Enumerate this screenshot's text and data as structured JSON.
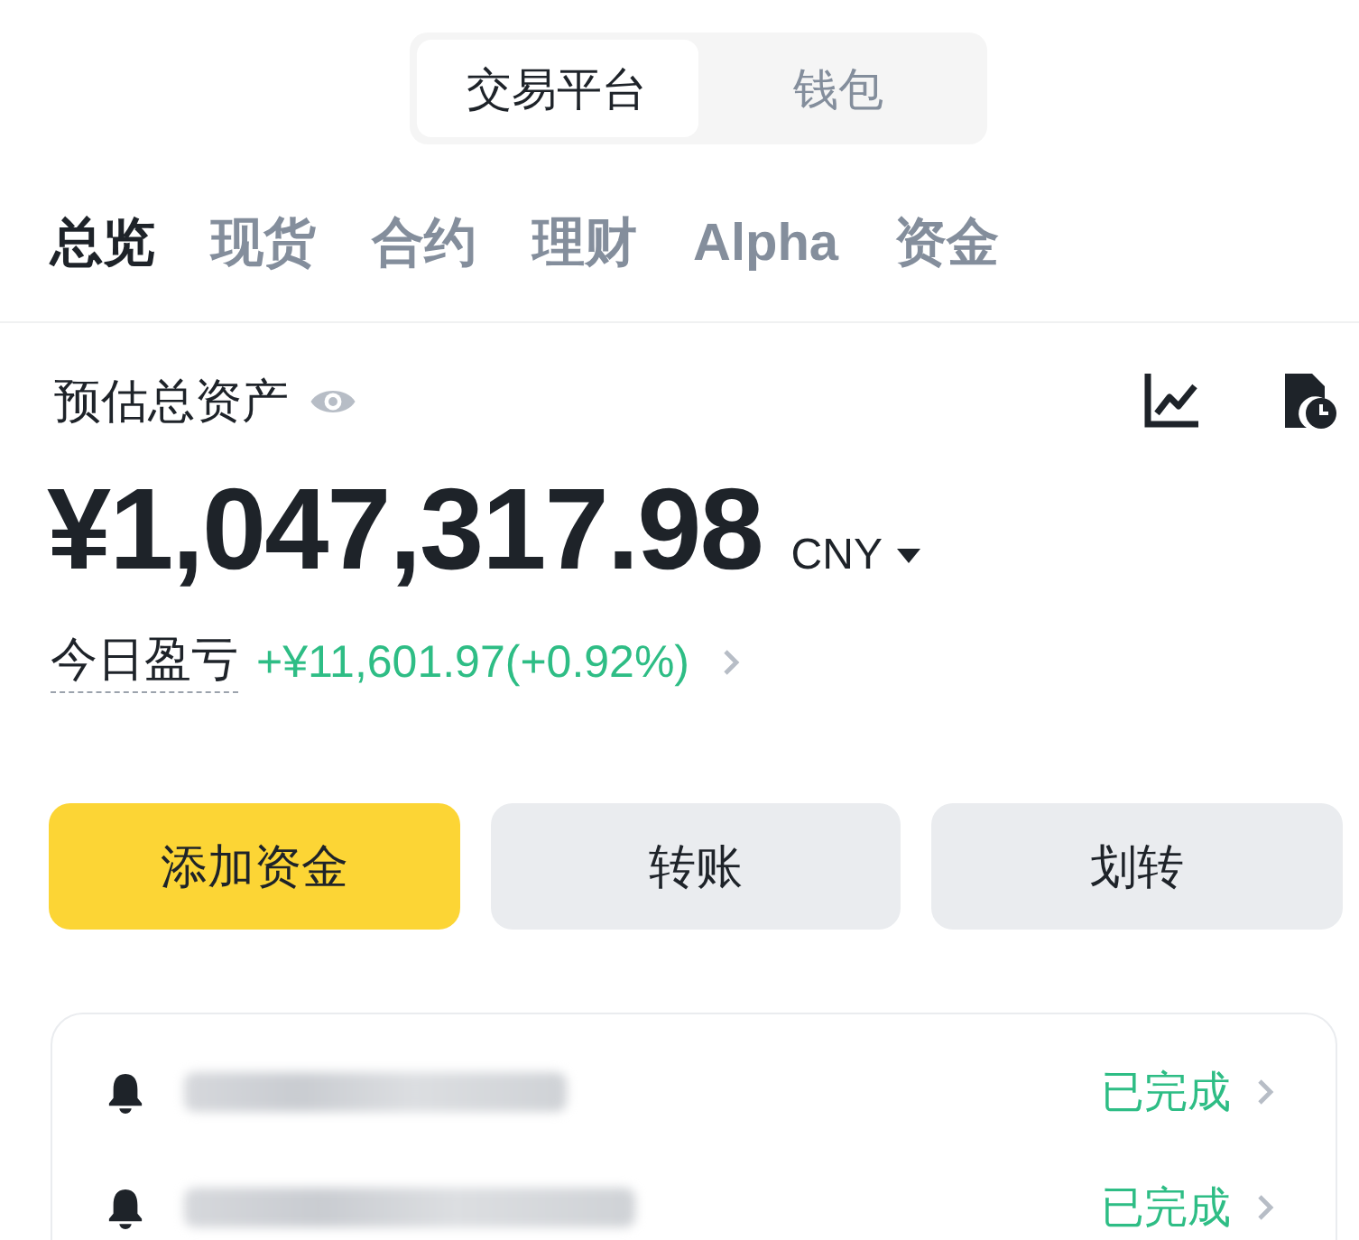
{
  "segmented_control": [
    {
      "label": "交易平台",
      "selected": true
    },
    {
      "label": "钱包",
      "selected": false
    }
  ],
  "tabs": [
    {
      "label": "总览",
      "selected": true
    },
    {
      "label": "现货",
      "selected": false
    },
    {
      "label": "合约",
      "selected": false
    },
    {
      "label": "理财",
      "selected": false
    },
    {
      "label": "Alpha",
      "selected": false
    },
    {
      "label": "资金",
      "selected": false
    }
  ],
  "balance": {
    "label": "预估总资产",
    "amount": "¥1,047,317.98",
    "currency": "CNY"
  },
  "pnl": {
    "label": "今日盈亏",
    "value": "+¥11,601.97(+0.92%)"
  },
  "actions": [
    {
      "label": "添加资金",
      "kind": "primary"
    },
    {
      "label": "转账",
      "kind": "secondary"
    },
    {
      "label": "划转",
      "kind": "secondary"
    }
  ],
  "notifications": [
    {
      "status": "已完成"
    },
    {
      "status": "已完成"
    }
  ]
}
